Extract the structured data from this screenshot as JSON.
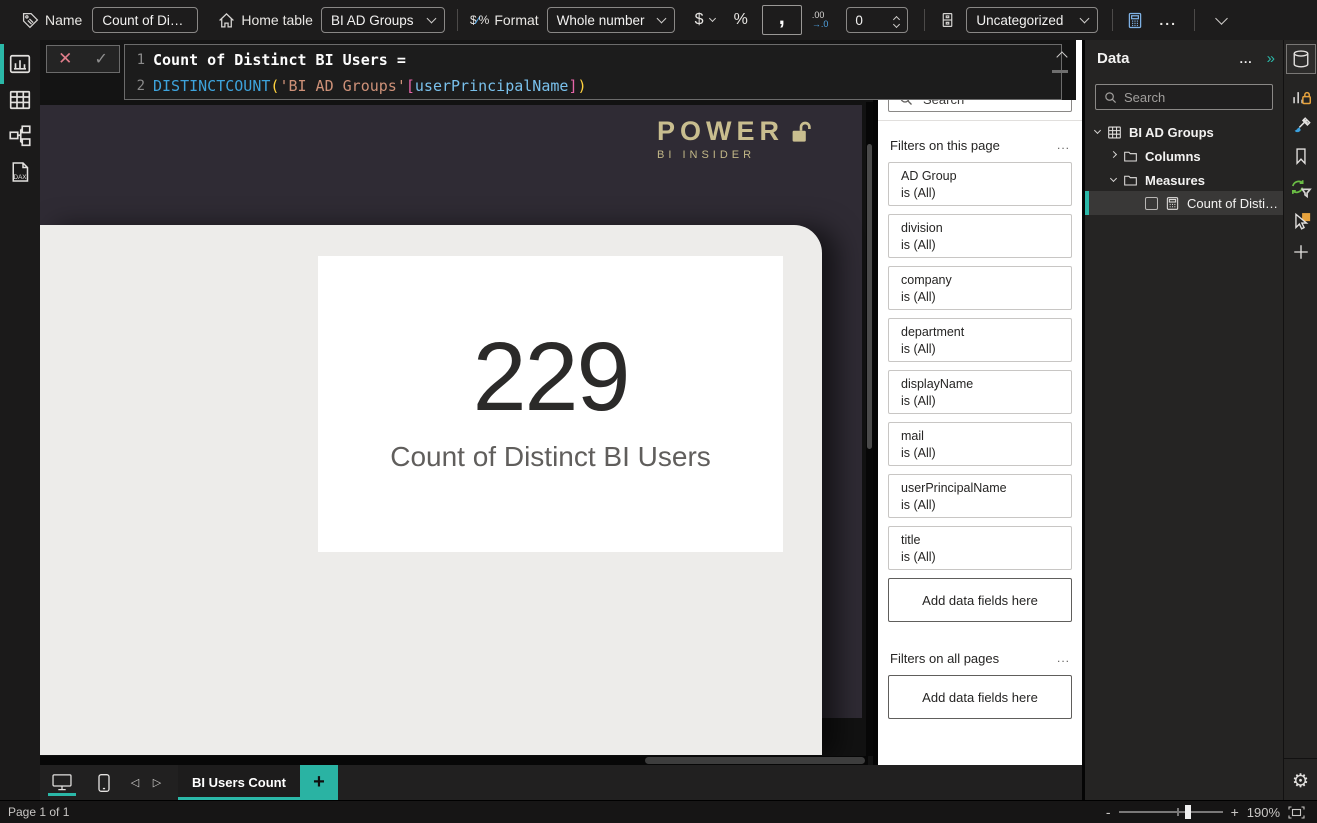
{
  "toolbar": {
    "name_label": "Name",
    "name_value": "Count of Distin...",
    "home_label": "Home table",
    "home_value": "BI AD Groups",
    "format_label": "Format",
    "format_value": "Whole number",
    "currency_symbol": "$",
    "percent_symbol": "%",
    "comma_symbol": ",",
    "decimal_icon_top": ".00",
    "decimal_icon_bottom": "→.0",
    "decimals_value": "0",
    "category_value": "Uncategorized",
    "more_label": "..."
  },
  "formula": {
    "cancel": "✕",
    "commit": "✓",
    "line1_no": "1",
    "line2_no": "2",
    "line1_text": "Count of Distinct BI Users =",
    "line2_tokens": [
      "DISTINCTCOUNT",
      "(",
      "'BI AD Groups'",
      "[",
      "userPrincipalName",
      "]",
      ")"
    ]
  },
  "canvas": {
    "logo_title": "POWER",
    "logo_subtitle": "BI INSIDER",
    "card_value": "229",
    "card_label": "Count of Distinct BI Users"
  },
  "filters": {
    "search_placeholder": "Search",
    "section1_title": "Filters on this page",
    "section2_title": "Filters on all pages",
    "more_label": "...",
    "add_placeholder": "Add data fields here",
    "cards": [
      {
        "field": "AD Group",
        "op": "is (All)"
      },
      {
        "field": "division",
        "op": "is (All)"
      },
      {
        "field": "company",
        "op": "is (All)"
      },
      {
        "field": "department",
        "op": "is (All)"
      },
      {
        "field": "displayName",
        "op": "is (All)"
      },
      {
        "field": "mail",
        "op": "is (All)"
      },
      {
        "field": "userPrincipalName",
        "op": "is (All)"
      },
      {
        "field": "title",
        "op": "is (All)"
      }
    ]
  },
  "data_pane": {
    "title": "Data",
    "more_label": "...",
    "collapse_label": "»",
    "search_placeholder": "Search",
    "table_name": "BI AD Groups",
    "columns_folder": "Columns",
    "measures_folder": "Measures",
    "measure_name": "Count of Distinct..."
  },
  "pages": {
    "tab_label": "BI Users Count",
    "add_label": "+",
    "prev_arrow": "◁",
    "next_arrow": "▷"
  },
  "status": {
    "page_indicator": "Page 1 of 1",
    "zoom_minus": "-",
    "zoom_plus": "+",
    "zoom_level": "190%"
  }
}
